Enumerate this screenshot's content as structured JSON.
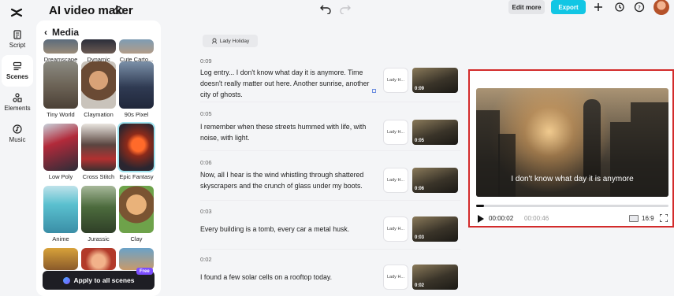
{
  "header": {
    "title": "AI video maker",
    "edit_more": "Edit more",
    "export": "Export"
  },
  "leftnav": {
    "items": [
      {
        "label": "Script",
        "icon": "script-icon",
        "active": false
      },
      {
        "label": "Scenes",
        "icon": "scenes-icon",
        "active": true
      },
      {
        "label": "Elements",
        "icon": "elements-icon",
        "active": false
      },
      {
        "label": "Music",
        "icon": "music-icon",
        "active": false
      }
    ]
  },
  "media": {
    "title": "Media",
    "styles": [
      {
        "label": "Dreamscape"
      },
      {
        "label": "Dynamic"
      },
      {
        "label": "Cute Carto..."
      },
      {
        "label": "Tiny World"
      },
      {
        "label": "Claymation"
      },
      {
        "label": "90s Pixel"
      },
      {
        "label": "Low Poly"
      },
      {
        "label": "Cross Stitch"
      },
      {
        "label": "Epic Fantasy"
      },
      {
        "label": "Anime"
      },
      {
        "label": "Jurassic"
      },
      {
        "label": "Clay"
      }
    ],
    "apply_label": "Apply to all scenes",
    "free_badge": "Free"
  },
  "script": {
    "voice": "Lady Holiday",
    "scenes": [
      {
        "time": "0:09",
        "text": "Log entry... I don't know what day it is anymore. Time doesn't really matter out here. Another sunrise, another city of ghosts.",
        "voice": "Lady H...",
        "duration": "0:09"
      },
      {
        "time": "0:05",
        "text": "I remember when these streets hummed with life, with noise, with light.",
        "voice": "Lady H...",
        "duration": "0:05"
      },
      {
        "time": "0:06",
        "text": "Now, all I hear is the wind whistling through shattered skyscrapers and the crunch of glass under my boots.",
        "voice": "Lady H...",
        "duration": "0:06"
      },
      {
        "time": "0:03",
        "text": "Every building is a tomb, every car a metal husk.",
        "voice": "Lady H...",
        "duration": "0:03"
      },
      {
        "time": "0:02",
        "text": "I found a few solar cells on a rooftop today.",
        "voice": "Lady H...",
        "duration": "0:02"
      }
    ]
  },
  "preview": {
    "caption": "I don't know what day it is anymore",
    "current_time": "00:00:02",
    "total_time": "00:00:46",
    "progress": 0.043,
    "aspect_ratio": "16:9"
  },
  "colors": {
    "accent": "#12c6e4",
    "highlight_border": "#d32b2b",
    "apply_button": "#1e1e24"
  }
}
